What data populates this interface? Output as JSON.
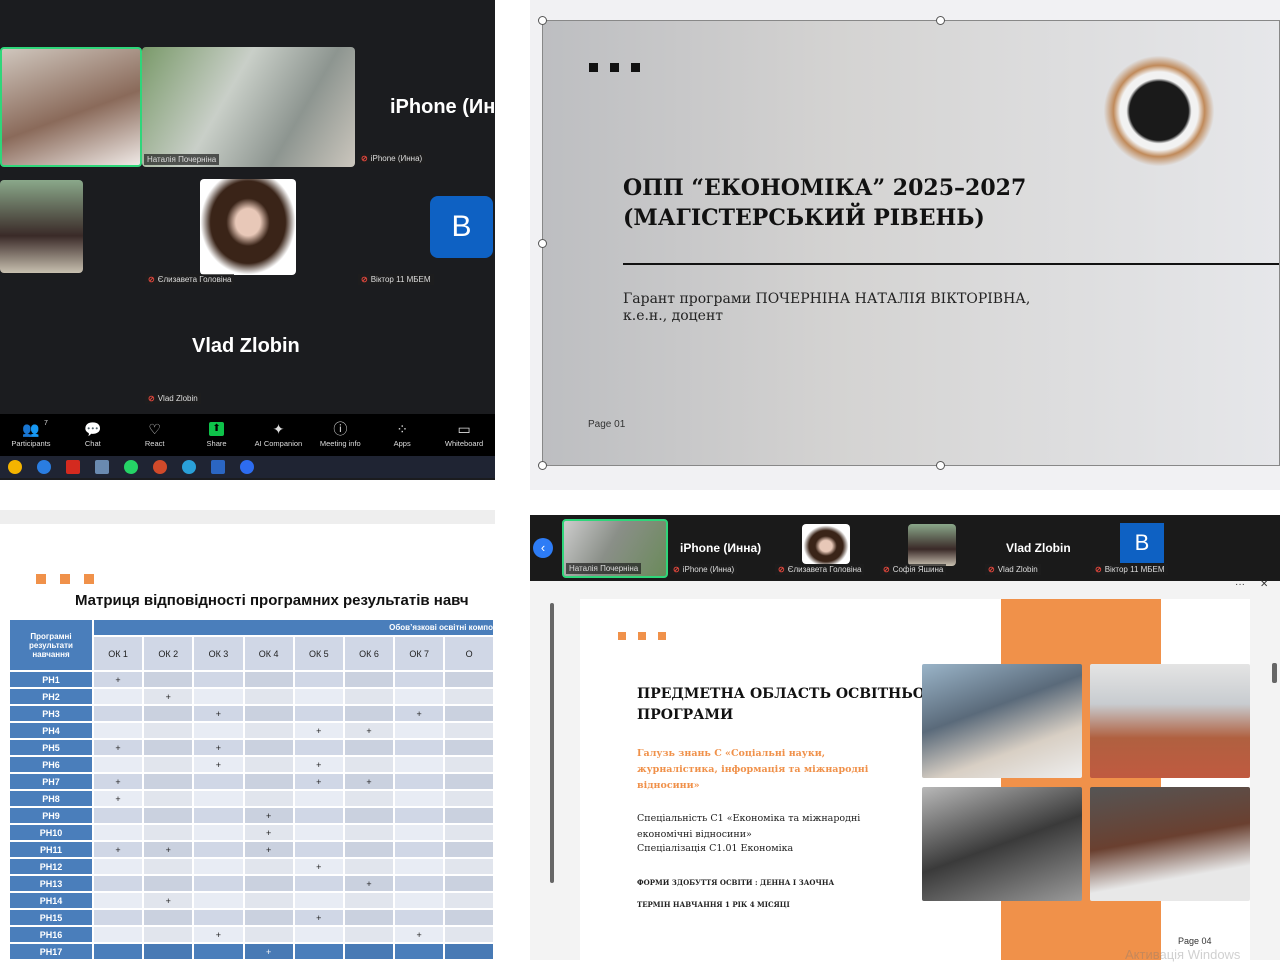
{
  "zoom_gallery": {
    "tiles": [
      {
        "name": "Наталія Почерніна"
      },
      {
        "name": "iPhone (Инна)",
        "display": "iPhone (Ин"
      },
      {
        "name": "Єлизавета Головіна"
      },
      {
        "name": "Віктор 11 МБЕМ",
        "avatar": "B"
      },
      {
        "name": "Vlad Zlobin",
        "display": "Vlad Zlobin"
      }
    ],
    "toolbar": [
      {
        "label": "Participants",
        "icon": "participants-icon",
        "glyph": "👥",
        "count": "7"
      },
      {
        "label": "Chat",
        "icon": "chat-icon",
        "glyph": "💬"
      },
      {
        "label": "React",
        "icon": "heart-icon",
        "glyph": "♡"
      },
      {
        "label": "Share",
        "icon": "share-icon",
        "glyph": "⬆"
      },
      {
        "label": "AI Companion",
        "icon": "sparkle-icon",
        "glyph": "✦"
      },
      {
        "label": "Meeting info",
        "icon": "info-icon",
        "glyph": "ⓘ"
      },
      {
        "label": "Apps",
        "icon": "apps-icon",
        "glyph": "⁘"
      },
      {
        "label": "Whiteboard",
        "icon": "whiteboard-icon",
        "glyph": "▭"
      }
    ]
  },
  "slide1": {
    "title_line1": "ОПП “ЕКОНОМІКА” 2025–2027",
    "title_line2": "(МАГІСТЕРСЬКИЙ РІВЕНЬ)",
    "subtitle_line1": "Гарант програми ПОЧЕРНІНА НАТАЛІЯ ВІКТОРІВНА,",
    "subtitle_line2": "к.е.н., доцент",
    "page": "Page 01",
    "colors": {
      "accent": "#111111"
    }
  },
  "matrix": {
    "title": "Матриця відповідності програмних результатів навч",
    "row_header": "Програмні результати навчання",
    "group_header": "Обов’язкові освітні компо",
    "columns": [
      "ОК 1",
      "ОК 2",
      "ОК 3",
      "ОК 4",
      "ОК 5",
      "ОК 6",
      "ОК 7",
      "О"
    ],
    "rows": [
      {
        "label": "PH1",
        "marks": [
          1
        ]
      },
      {
        "label": "PH2",
        "marks": [
          2
        ]
      },
      {
        "label": "PH3",
        "marks": [
          3,
          7
        ]
      },
      {
        "label": "PH4",
        "marks": [
          5,
          6
        ]
      },
      {
        "label": "PH5",
        "marks": [
          1,
          3
        ]
      },
      {
        "label": "PH6",
        "marks": [
          3,
          5
        ]
      },
      {
        "label": "PH7",
        "marks": [
          1,
          5,
          6
        ]
      },
      {
        "label": "PH8",
        "marks": [
          1
        ]
      },
      {
        "label": "PH9",
        "marks": [
          4
        ]
      },
      {
        "label": "PH10",
        "marks": [
          4
        ]
      },
      {
        "label": "PH11",
        "marks": [
          1,
          2,
          4
        ]
      },
      {
        "label": "PH12",
        "marks": [
          5
        ]
      },
      {
        "label": "PH13",
        "marks": [
          6
        ]
      },
      {
        "label": "PH14",
        "marks": [
          2
        ]
      },
      {
        "label": "PH15",
        "marks": [
          5
        ]
      },
      {
        "label": "PH16",
        "marks": [
          3,
          7
        ]
      },
      {
        "label": "PH17",
        "marks": [
          4
        ]
      }
    ],
    "mark": "+",
    "colors": {
      "header": "#4a7ebb",
      "accent": "#f0914a"
    }
  },
  "strip": {
    "tiles": [
      {
        "name": "Наталія Почерніна"
      },
      {
        "name": "iPhone (Инна)",
        "display": "iPhone (Инна)"
      },
      {
        "name": "Єлизавета Головіна"
      },
      {
        "name": "Софія Яшина"
      },
      {
        "name": "Vlad Zlobin",
        "display": "Vlad Zlobin"
      },
      {
        "name": "Віктор 11 МБЕМ",
        "avatar": "B"
      }
    ],
    "more": "···",
    "close": "✕"
  },
  "slide2": {
    "title_line1": "ПРЕДМЕТНА ОБЛАСТЬ ОСВІТНЬОЇ",
    "title_line2": "ПРОГРАМИ",
    "field": "Галузь знань С «Соціальні науки, журналістика, інформація та міжнародні відносини»",
    "specialty": "Спеціальність С1 «Економіка та міжнародні економічні відносини»",
    "specialization": "Спеціалізація С1.01 Економіка",
    "forms": "ФОРМИ ЗДОБУТТЯ ОСВІТИ : ДЕННА І ЗАОЧНА",
    "term": "ТЕРМІН НАВЧАННЯ 1 РІК 4 МІСЯЦІ",
    "page": "Page 04",
    "watermark": "Активація Windows",
    "colors": {
      "accent": "#f0914a"
    }
  }
}
